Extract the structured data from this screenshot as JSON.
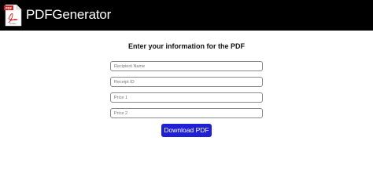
{
  "app": {
    "brand": "PDFGenerator",
    "logo_icon": "pdf-file-icon",
    "logo_tag": "PDF",
    "logo_caption": "Adobe"
  },
  "colors": {
    "navbar_bg": "#000000",
    "brand_text": "#ffffff",
    "button_bg": "#1f1fd6",
    "button_text": "#ffffff",
    "logo_red": "#d4201f"
  },
  "form": {
    "heading": "Enter your information for the PDF",
    "fields": [
      {
        "placeholder": "Recipient Name",
        "value": ""
      },
      {
        "placeholder": "Receipt ID",
        "value": ""
      },
      {
        "placeholder": "Price 1",
        "value": ""
      },
      {
        "placeholder": "Price 2",
        "value": ""
      }
    ],
    "submit_label": "Download PDF"
  }
}
